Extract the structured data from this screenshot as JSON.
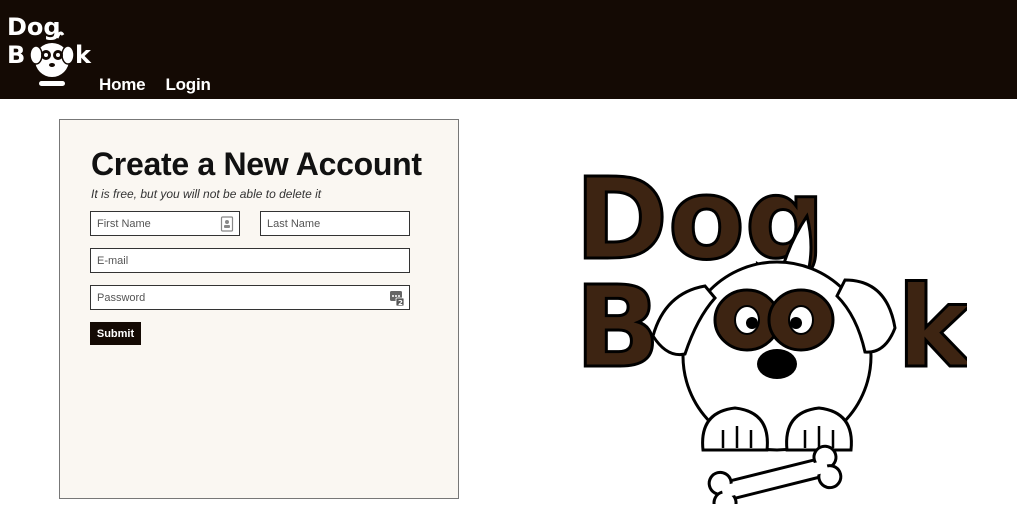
{
  "header": {
    "logo_text_line1": "Dog",
    "logo_text_line2": "Bk",
    "nav": [
      {
        "label": "Home"
      },
      {
        "label": "Login"
      }
    ],
    "background": "#140a04"
  },
  "signup": {
    "title": "Create a New Account",
    "subtitle": "It is free, but you will not be able to delete it",
    "first_name": {
      "value": "",
      "placeholder": "First Name"
    },
    "last_name": {
      "value": "",
      "placeholder": "Last Name"
    },
    "email": {
      "value": "",
      "placeholder": "E-mail"
    },
    "password": {
      "value": "",
      "placeholder": "Password"
    },
    "submit_label": "Submit",
    "icons": [
      "contact-card-icon",
      "password-manager-icon"
    ]
  },
  "brand": {
    "logo_text_line1": "Dog",
    "logo_text_line2": "Bk",
    "colors": {
      "letters": "#3d2412",
      "outline": "#000000"
    }
  }
}
